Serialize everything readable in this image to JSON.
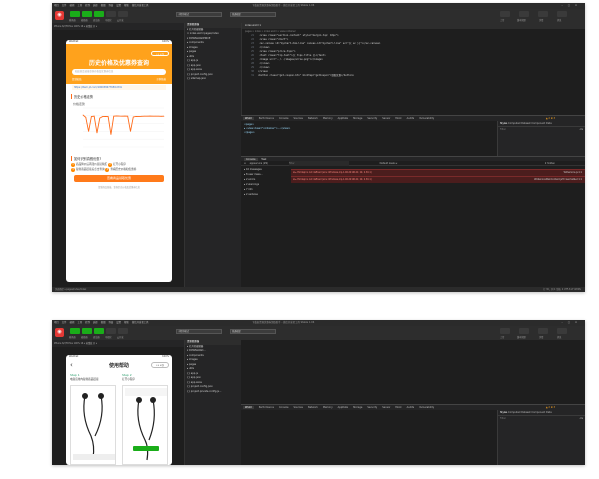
{
  "menu": [
    "项目",
    "文件",
    "编辑",
    "工具",
    "转到",
    "选择",
    "视图",
    "界面",
    "设置",
    "帮助",
    "微信开发者工具"
  ],
  "window_title": "下载表资源优惠券领取助手 - 微信开发者工具 Stable 1.06",
  "toolbar": {
    "buttons": [
      "模拟器",
      "编辑器",
      "调试器",
      "可视化",
      "云开发"
    ],
    "mode_dropdown": "小程序模式",
    "compile_dropdown": "普通编译",
    "right_buttons": [
      "上传",
      "版本管理",
      "详情",
      "消息"
    ],
    "button_colors": [
      "#1aad19",
      "#1aad19",
      "#1aad19",
      "#3a3a3a",
      "#3a3a3a"
    ]
  },
  "sim_bar": "iPhone 6/7/8 Plus 100% 16 ▾  热重载 开 ▾",
  "phone1": {
    "status_left": "WeChat",
    "status_right": "100%",
    "title": "历史价格及优惠券查询",
    "search_placeholder": "粘贴商品链接查询价格及优惠券信息",
    "paste_left": "复制粘贴",
    "paste_right": "示例链接",
    "url": "https://item.jd.com/100038477656.html",
    "history_header": "历史价格走势",
    "price_label": "价格走势",
    "questions_header": "如何识别真假优惠?",
    "questions": [
      "商品降价后再涨价直接购买",
      "打开小程序",
      "复制商品链接后点击查询",
      "查看历史价格和优惠券"
    ],
    "button": "查看商品领取优惠",
    "footnote": "复制商品链接，查询历史价格及优惠券信息"
  },
  "chart_data": {
    "type": "line",
    "title": "价格走势",
    "ylim": [
      0,
      500
    ],
    "x": [
      1,
      2,
      3,
      4,
      5,
      6,
      7,
      8,
      9,
      10,
      11,
      12,
      13,
      14,
      15,
      16,
      17,
      18,
      19,
      20,
      21,
      22,
      23,
      24,
      25,
      26,
      27,
      28,
      29,
      30
    ],
    "values": [
      410,
      380,
      200,
      390,
      395,
      180,
      370,
      390,
      392,
      390,
      160,
      395,
      398,
      396,
      395,
      396,
      395,
      200,
      385,
      392,
      390,
      394,
      395,
      395,
      396,
      395,
      395,
      395,
      394,
      395
    ]
  },
  "tree1": {
    "header": "资源管理器",
    "items": [
      "▾ 打开的编辑器",
      "  × index.wxml  pages/index",
      "▾ DOWNLOADPRICE",
      "  ▸ components",
      "  ▸ images",
      "  ▸ pages",
      "  ▸ utils",
      "  {} app.js",
      "  {} app.json",
      "  {} app.wxss",
      "  {} project.config.json",
      "  {} sitemap.json"
    ]
  },
  "editor": {
    "tab": "index.wxml ×",
    "breadcrumb": "pages > index > index.wxml > view.container",
    "lines": [
      {
        "n": "21",
        "t": "  <view class=\"section-content\" style=\"margin-top: 10px\">"
      },
      {
        "n": "22",
        "t": "    <view class=\"chart\">"
      },
      {
        "n": "23",
        "t": "      <ec-canvas id=\"mychart-dom-line\" canvas-id=\"mychart-line\" ec=\"{{ ec }}\"></ec-canvas>"
      },
      {
        "n": "24",
        "t": "    </view>"
      },
      {
        "n": "25",
        "t": "    <view class=\"price-tips\">"
      },
      {
        "n": "26",
        "t": "      <text class=\"tip-text\">{{ tips.title }}</text>"
      },
      {
        "n": "27",
        "t": "      <image src=\"../../images/arrow.png\"></image>"
      },
      {
        "n": "28",
        "t": "    </view>"
      },
      {
        "n": "29",
        "t": "  </view>"
      },
      {
        "n": "30",
        "t": "</view>"
      },
      {
        "n": "31",
        "t": "<button class=\"get-coupon-btn\" bindtap=\"getCoupon\">领取优惠</button>"
      }
    ]
  },
  "devtools": {
    "tabs": [
      "Wxml",
      "Performance",
      "Console",
      "Sources",
      "Network",
      "Memory",
      "AppData",
      "Storage",
      "Security",
      "Sensor",
      "Mock",
      "Audits",
      "Vulnerability"
    ],
    "active_tab": "Wxml",
    "dom_lines": [
      "<page>",
      "  ▸ <view class=\"container\">…</view>",
      "</page>"
    ],
    "right_tabs": [
      "Styles",
      "Computed",
      "Dataset",
      "Component Data"
    ],
    "filter_placeholder": "Filter",
    "filter_right": ".cls",
    "badges": "▲ 2  ✖ 3",
    "console_tabs": [
      "Console",
      "Task"
    ],
    "console_context": "appservice (#2)",
    "console_filter": "Filter",
    "console_levels": "Default levels ▾",
    "console_hidden": "2 hidden",
    "sidebar": [
      "▸ 10 messages",
      "▸ 8 user mess...",
      "▸ 2 errors",
      "▸ 2 warnings",
      "▸ 7 info",
      "▸ 2 verbose"
    ],
    "errors": [
      {
        "text": "✖ ▸ thirdapi is not defined (env: Windows,mp,1.06.2210141; lib: 2.30.1)",
        "src": "WAService.js:1:1"
      },
      {
        "text": "✖ ▸ thirdapi is not defined (env: Windows,mp,1.06.2210141; lib: 2.30.1)",
        "src": "WAServiceMainContext.js?t=wechat&s=1:1"
      }
    ]
  },
  "statusbar1": "页面路径 ▾ pages/index/index",
  "statusbar_right": "行 30，列 1  空格: 2  UTF-8  LF  WXML",
  "phone2": {
    "status_left": "WeChat",
    "status_right": "100%",
    "title": "使用帮助",
    "step1": "Step 1",
    "step1_desc": "电商应用内复制商品链接",
    "step2": "Step 2",
    "step2_desc": "打开小程序"
  },
  "tree2": {
    "header": "资源管理器",
    "items": [
      "▸ 打开的编辑器",
      "▾ DOWNLOAD...",
      "  ▸ components",
      "  ▸ images",
      "  ▸ pages",
      "  ▸ utils",
      "  {} app.js",
      "  {} app.json",
      "  {} app.wxss",
      "  {} project.config.json",
      "  {} project.private.config.js..."
    ]
  }
}
